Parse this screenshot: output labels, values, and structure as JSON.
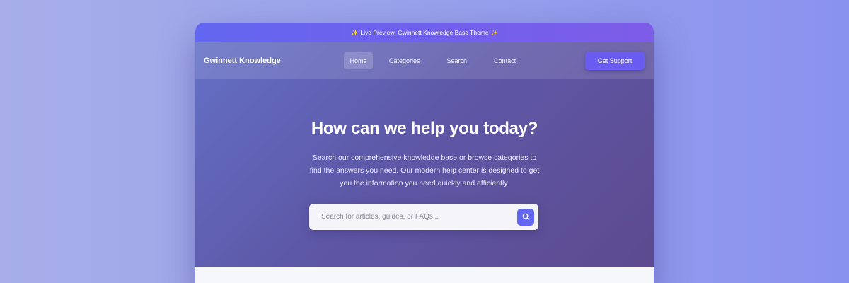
{
  "banner": {
    "sparkle_left": "✨",
    "text": "Live Preview: Gwinnett Knowledge Base Theme",
    "sparkle_right": "✨"
  },
  "navbar": {
    "brand": "Gwinnett Knowledge",
    "links": [
      {
        "label": "Home",
        "active": true
      },
      {
        "label": "Categories",
        "active": false
      },
      {
        "label": "Search",
        "active": false
      },
      {
        "label": "Contact",
        "active": false
      }
    ],
    "cta_label": "Get Support"
  },
  "hero": {
    "title": "How can we help you today?",
    "subtitle": "Search our comprehensive knowledge base or browse categories to find the answers you need. Our modern help center is designed to get you the information you need quickly and efficiently."
  },
  "search": {
    "value": "",
    "placeholder": "Search for articles, guides, or FAQs...",
    "icon": "search-icon"
  },
  "colors": {
    "accent": "#6366f1",
    "banner_gradient_start": "#6366f1",
    "banner_gradient_end": "#7d5ce8",
    "hero_gradient_start": "#6470c6",
    "hero_gradient_end": "#5d4a8f",
    "cta_background": "#6a5cf0"
  }
}
